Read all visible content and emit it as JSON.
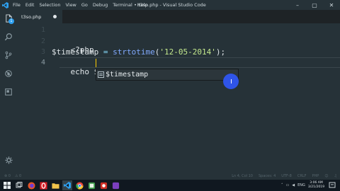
{
  "titlebar": {
    "menu": [
      "File",
      "Edit",
      "Selection",
      "View",
      "Go",
      "Debug",
      "Terminal",
      "Help"
    ],
    "title": "• t3so.php - Visual Studio Code",
    "controls": {
      "minimize": "–",
      "maximize": "▢",
      "close": "✕"
    }
  },
  "activity": {
    "badge": "1",
    "icons": [
      "files-icon",
      "search-icon",
      "source-control-icon",
      "debug-icon",
      "extensions-icon",
      "gear-icon"
    ]
  },
  "tab": {
    "label": "t3so.php",
    "dirty": true
  },
  "editor": {
    "line_numbers": [
      "1",
      "2",
      "3",
      "4"
    ],
    "lines": {
      "l2": {
        "text": "<?php"
      },
      "l3": {
        "var": "$timestamp",
        "eq": " = ",
        "func": "strtotime",
        "open": "(",
        "str": "'12-05-2014'",
        "close": ");"
      },
      "l4": {
        "text": "echo $tim"
      }
    },
    "suggestion": "$timestamp"
  },
  "statusbar": {
    "left": {
      "errors": "⊗ 0",
      "warnings": "⚠ 0"
    },
    "right": [
      "Ln 4, Col 10",
      "Spaces: 4",
      "UTF-8",
      "CRLF",
      "PHP"
    ]
  },
  "taskbar": {
    "clock_time": "3:06 AM",
    "clock_date": "3/21/2019"
  },
  "colors": {
    "editor_bg": "#263238",
    "string": "#c3e88d",
    "function": "#82aaff",
    "operator": "#89ddff",
    "cursor": "#ffcc00",
    "pointer_highlight": "#2f54e8"
  }
}
